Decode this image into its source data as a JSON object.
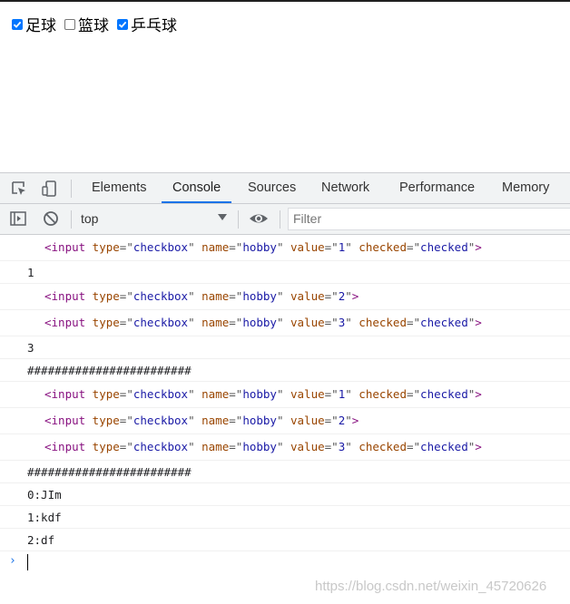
{
  "page": {
    "checkboxes": [
      {
        "label": "足球",
        "checked": true
      },
      {
        "label": "篮球",
        "checked": false
      },
      {
        "label": "乒乓球",
        "checked": true
      }
    ]
  },
  "devtools": {
    "icons": [
      "inspect-element-icon",
      "device-toolbar-icon"
    ],
    "tabs": [
      "Elements",
      "Console",
      "Sources",
      "Network",
      "Performance",
      "Memory"
    ],
    "active_tab": "Console",
    "toolbar": {
      "context": "top",
      "filter_placeholder": "Filter"
    },
    "console": {
      "logs": [
        {
          "kind": "element",
          "value": "1",
          "checked": "checked"
        },
        {
          "kind": "text",
          "text": "1"
        },
        {
          "kind": "element",
          "value": "2"
        },
        {
          "kind": "element",
          "value": "3",
          "checked": "checked"
        },
        {
          "kind": "text",
          "text": "3"
        },
        {
          "kind": "text",
          "text": "########################"
        },
        {
          "kind": "element",
          "value": "1",
          "checked": "checked"
        },
        {
          "kind": "element",
          "value": "2"
        },
        {
          "kind": "element",
          "value": "3",
          "checked": "checked"
        },
        {
          "kind": "text",
          "text": "########################"
        },
        {
          "kind": "text",
          "text": "0:JIm"
        },
        {
          "kind": "text",
          "text": "1:kdf"
        },
        {
          "kind": "text",
          "text": "2:df"
        }
      ],
      "element_template": {
        "tag": "input",
        "type": "checkbox",
        "name": "hobby"
      },
      "prompt_symbol": "›"
    }
  },
  "watermark": "https://blog.csdn.net/weixin_45720626"
}
